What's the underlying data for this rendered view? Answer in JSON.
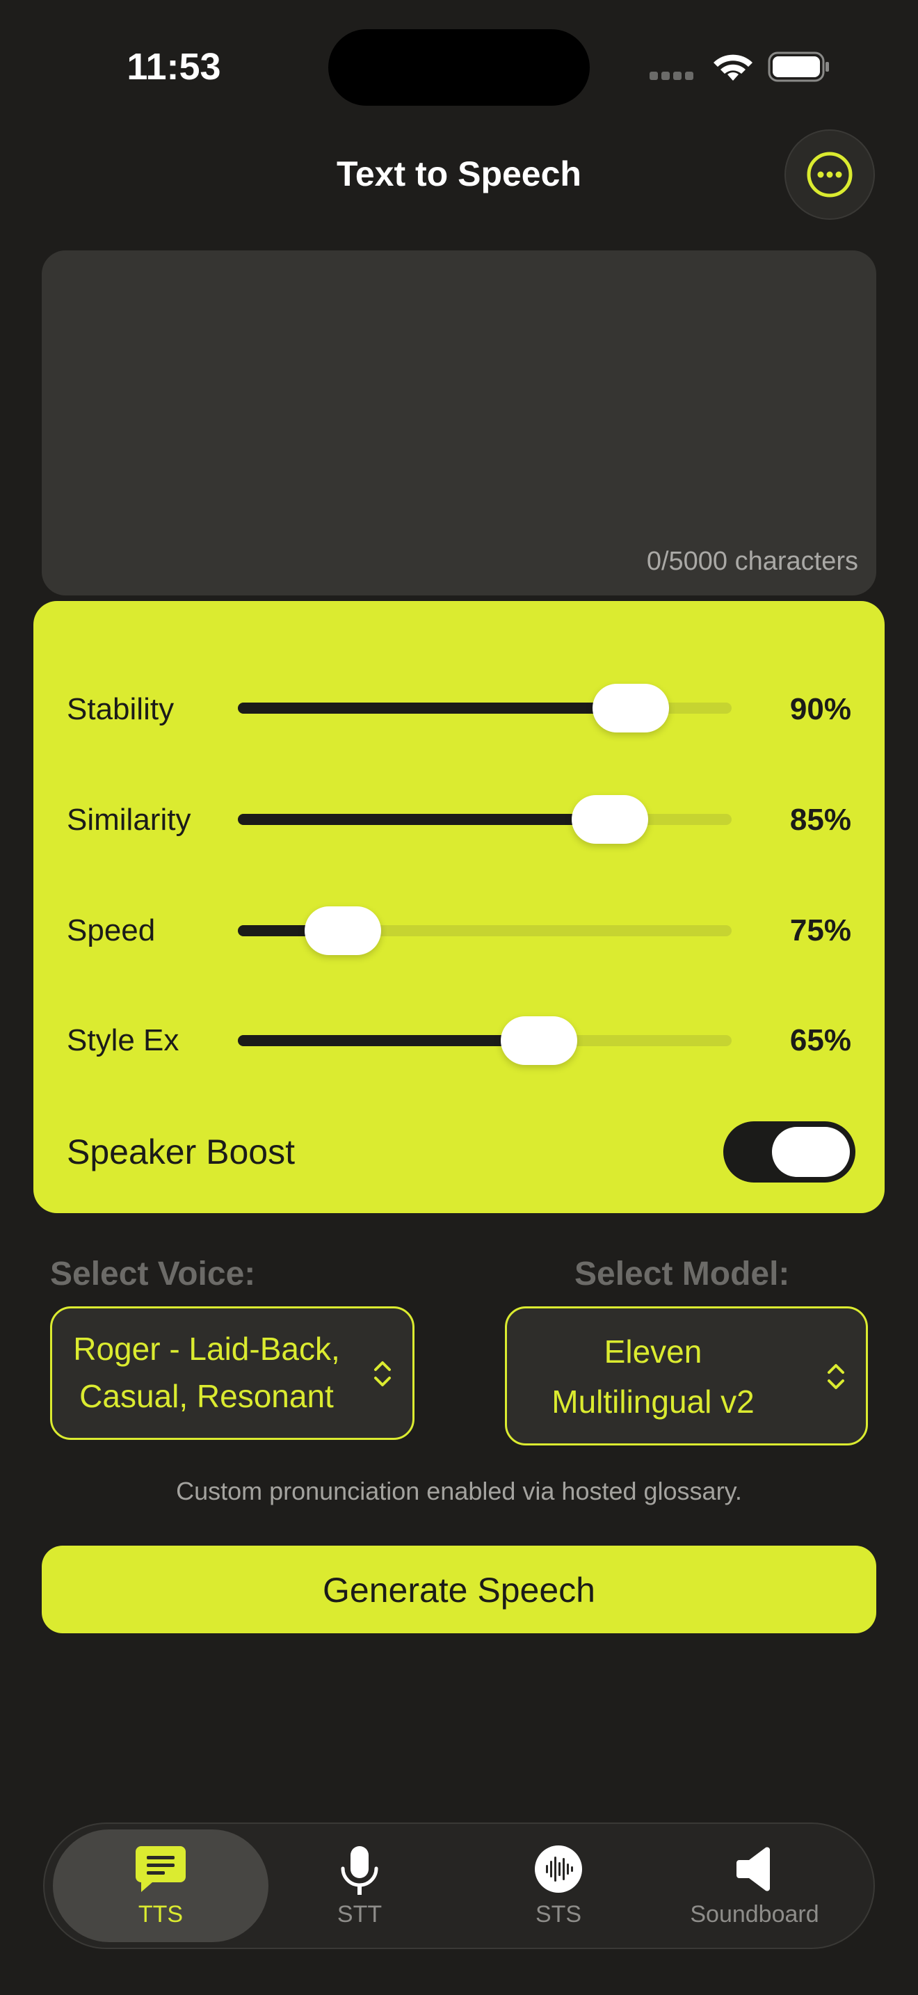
{
  "status_bar": {
    "time": "11:53"
  },
  "header": {
    "title": "Text to Speech",
    "more_icon": "ellipsis-circle-icon"
  },
  "text_input": {
    "value": "",
    "char_count": "0/5000 characters"
  },
  "colors": {
    "accent": "#dbeb30",
    "background": "#1e1d1b",
    "panel_text": "#1b1b19"
  },
  "settings": {
    "sliders": [
      {
        "label": "Stability",
        "value": "90%",
        "fraction": 0.85
      },
      {
        "label": "Similarity",
        "value": "85%",
        "fraction": 0.8
      },
      {
        "label": "Speed",
        "value": "75%",
        "fraction": 0.16
      },
      {
        "label": "Style Ex",
        "value": "65%",
        "fraction": 0.63
      }
    ],
    "speaker_boost": {
      "label": "Speaker Boost",
      "on": true
    }
  },
  "voice": {
    "label": "Select Voice:",
    "line1": "Roger - Laid-Back,",
    "line2": "Casual, Resonant"
  },
  "model": {
    "label": "Select Model:",
    "line1": "Eleven",
    "line2": "Multilingual v2"
  },
  "note": "Custom pronunciation enabled via hosted glossary.",
  "generate_label": "Generate Speech",
  "tabs": [
    {
      "label": "TTS",
      "icon": "message-icon",
      "active": true
    },
    {
      "label": "STT",
      "icon": "microphone-icon",
      "active": false
    },
    {
      "label": "STS",
      "icon": "waveform-icon",
      "active": false
    },
    {
      "label": "Soundboard",
      "icon": "speaker-icon",
      "active": false
    }
  ]
}
